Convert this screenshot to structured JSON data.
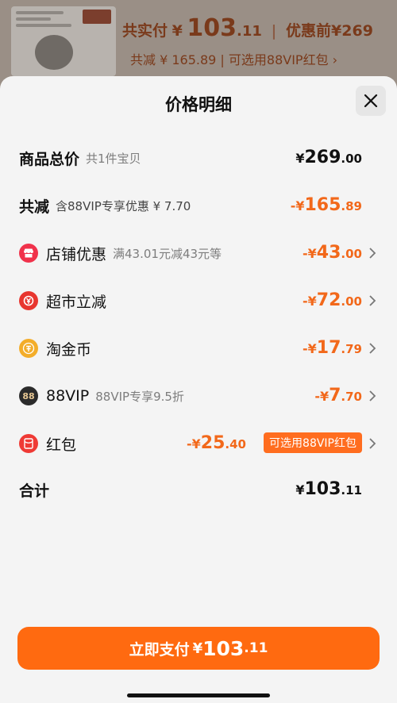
{
  "background": {
    "total_paid_label": "共实付",
    "currency": "¥",
    "total_paid_int": "103",
    "total_paid_dec": ".11",
    "separator": "|",
    "before_discount_label": "优惠前",
    "before_discount_value": "¥269",
    "discount_summary": "共减 ¥ 165.89 | 可选用88VIP红包 ›"
  },
  "sheet": {
    "title": "价格明细",
    "close_icon": "close-icon"
  },
  "rows": {
    "total": {
      "label": "商品总价",
      "note": "共1件宝贝",
      "cur": "¥",
      "int": "269",
      "dec": ".00"
    },
    "reduction": {
      "label": "共减",
      "note": "含88VIP专享优惠 ¥ 7.70",
      "cur": "-¥",
      "int": "165",
      "dec": ".89"
    },
    "shop": {
      "icon": "shop-icon",
      "label": "店铺优惠",
      "note": "满43.01元减43元等",
      "cur": "-¥",
      "int": "43",
      "dec": ".00"
    },
    "supermarket": {
      "icon": "supermarket-cut-icon",
      "label": "超市立减",
      "cur": "-¥",
      "int": "72",
      "dec": ".00"
    },
    "coin": {
      "icon": "gold-coin-icon",
      "label": "淘金币",
      "cur": "-¥",
      "int": "17",
      "dec": ".79"
    },
    "vip": {
      "icon": "vip88-icon",
      "icon_text": "88",
      "label": "88VIP",
      "note": "88VIP专享9.5折",
      "cur": "-¥",
      "int": "7",
      "dec": ".70"
    },
    "redbag": {
      "icon": "red-envelope-icon",
      "label": "红包",
      "cur": "-¥",
      "int": "25",
      "dec": ".40",
      "tag": "可选用88VIP红包"
    },
    "sum": {
      "label": "合计",
      "cur": "¥",
      "int": "103",
      "dec": ".11"
    }
  },
  "pay_button": {
    "label": "立即支付",
    "cur": "¥",
    "int": "103",
    "dec": ".11"
  },
  "colors": {
    "accent": "#ff6a10",
    "discount": "#f2681a",
    "sheet_bg": "#f4f4f4"
  }
}
